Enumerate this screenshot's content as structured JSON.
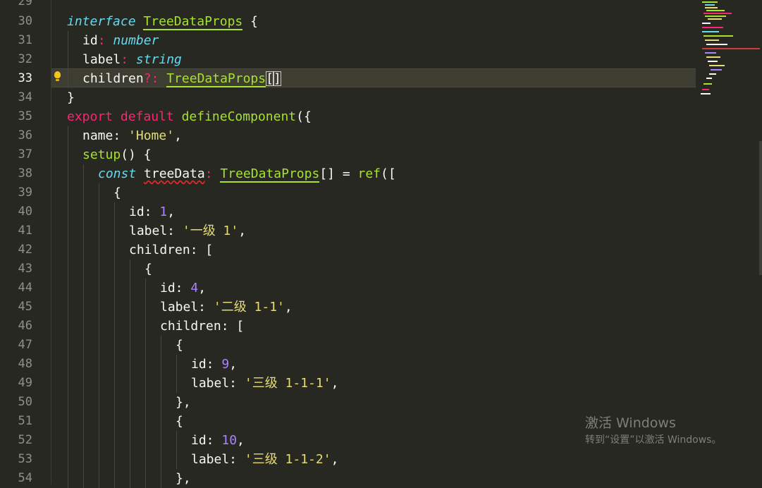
{
  "editor": {
    "theme": {
      "background": "#272822",
      "keyword": "#f92672",
      "storage": "#66d9ef",
      "type": "#a6e22e",
      "string": "#e6db74",
      "number": "#ae81ff"
    },
    "current_line_number": "33",
    "lines": [
      {
        "n": "29",
        "parts": []
      },
      {
        "n": "30",
        "parts": [
          "interface",
          "TreeDataProps",
          " {"
        ]
      },
      {
        "n": "31",
        "parts": [
          "id",
          ": ",
          "number"
        ]
      },
      {
        "n": "32",
        "parts": [
          "label",
          ": ",
          "string"
        ]
      },
      {
        "n": "33",
        "parts": [
          "children",
          "?: ",
          "TreeDataProps",
          "[",
          "]"
        ]
      },
      {
        "n": "34",
        "parts": [
          "}"
        ]
      },
      {
        "n": "35",
        "parts": [
          "export",
          "default",
          "defineComponent",
          "({"
        ]
      },
      {
        "n": "36",
        "parts": [
          "name: ",
          "'Home'",
          ","
        ]
      },
      {
        "n": "37",
        "parts": [
          "setup",
          "() {"
        ]
      },
      {
        "n": "38",
        "parts": [
          "const",
          "treeData",
          ": ",
          "TreeDataProps",
          "[] = ",
          "ref",
          "(["
        ]
      },
      {
        "n": "39",
        "parts": [
          "{"
        ]
      },
      {
        "n": "40",
        "parts": [
          "id: ",
          "1",
          ","
        ]
      },
      {
        "n": "41",
        "parts": [
          "label: ",
          "'一级 1'",
          ","
        ]
      },
      {
        "n": "42",
        "parts": [
          "children: ["
        ]
      },
      {
        "n": "43",
        "parts": [
          "{"
        ]
      },
      {
        "n": "44",
        "parts": [
          "id: ",
          "4",
          ","
        ]
      },
      {
        "n": "45",
        "parts": [
          "label: ",
          "'二级 1-1'",
          ","
        ]
      },
      {
        "n": "46",
        "parts": [
          "children: ["
        ]
      },
      {
        "n": "47",
        "parts": [
          "{"
        ]
      },
      {
        "n": "48",
        "parts": [
          "id: ",
          "9",
          ","
        ]
      },
      {
        "n": "49",
        "parts": [
          "label: ",
          "'三级 1-1-1'",
          ","
        ]
      },
      {
        "n": "50",
        "parts": [
          "},"
        ]
      },
      {
        "n": "51",
        "parts": [
          "{"
        ]
      },
      {
        "n": "52",
        "parts": [
          "id: ",
          "10",
          ","
        ]
      },
      {
        "n": "53",
        "parts": [
          "label: ",
          "'三级 1-1-2'",
          ","
        ]
      },
      {
        "n": "54",
        "parts": [
          "},"
        ]
      }
    ]
  },
  "watermark": {
    "title": "激活 Windows",
    "subtitle": "转到“设置”以激活 Windows。"
  },
  "icons": {
    "lightbulb": "lightbulb-icon"
  }
}
